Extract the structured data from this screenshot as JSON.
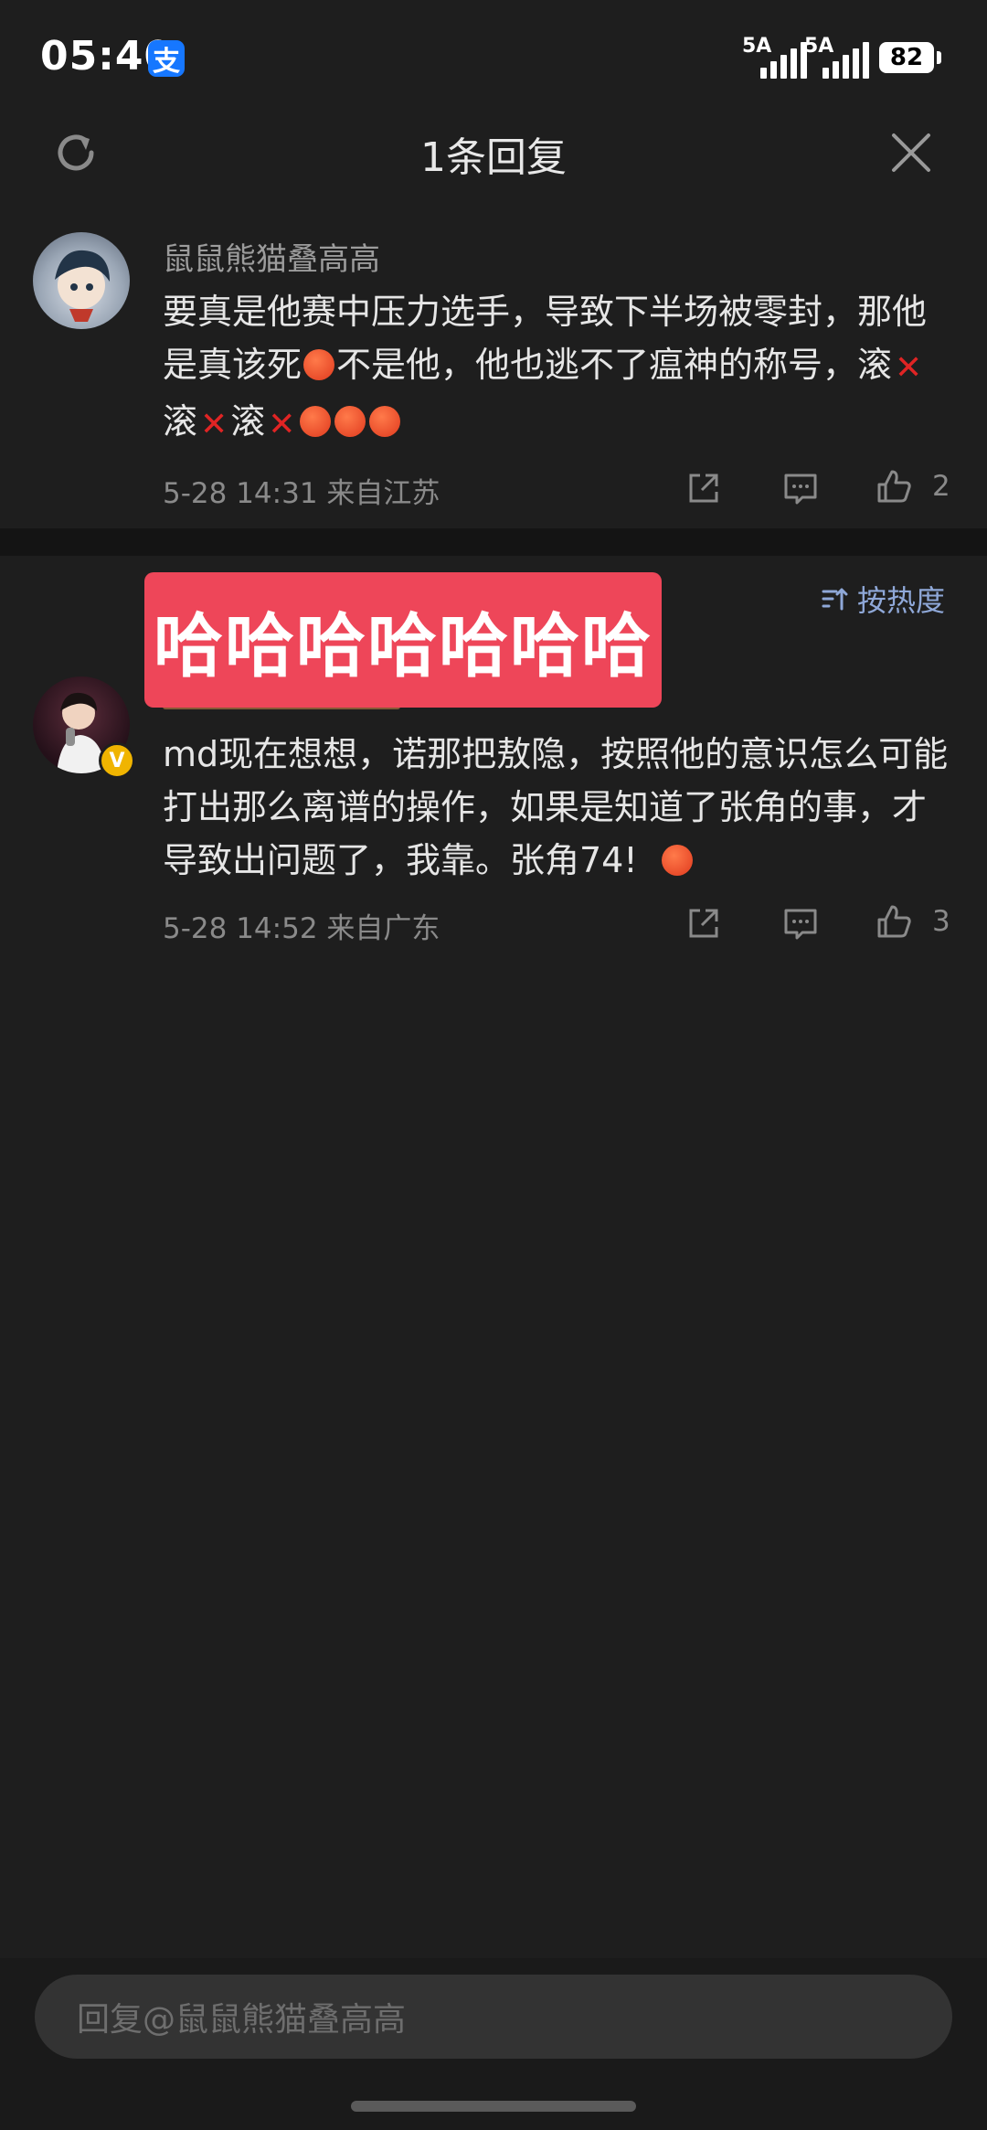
{
  "status_bar": {
    "time": "05:40",
    "app_badge": "支",
    "signal1_label": "5A",
    "signal2_label": "5A",
    "battery": "82"
  },
  "header": {
    "title": "1条回复",
    "refresh_icon": "refresh-icon",
    "close_icon": "close-icon"
  },
  "parent_comment": {
    "user": "鼠鼠熊猫叠高高",
    "text_part1": "要真是他赛中压力选手，导致下半场被零封，那他是真该死",
    "text_part2": "不是他，他也逃不了瘟神的称号，滚",
    "text_part3": "滚",
    "text_part4": "滚",
    "meta": "5-28 14:31 来自江苏",
    "likes": "2"
  },
  "sort": {
    "label": "按热度",
    "icon": "sort-icon"
  },
  "sticker": {
    "text": "哈哈哈哈哈哈哈"
  },
  "reply_comment": {
    "text": "md现在想想，诺那把敖隐，按照他的意识怎么可能打出那么离谱的操作，如果是知道了张角的事，才导致出问题了，我靠。张角74!",
    "meta": "5-28 14:52 来自广东",
    "likes": "3",
    "verified_badge": "V"
  },
  "reply_input": {
    "placeholder": "回复@鼠鼠熊猫叠高高"
  }
}
